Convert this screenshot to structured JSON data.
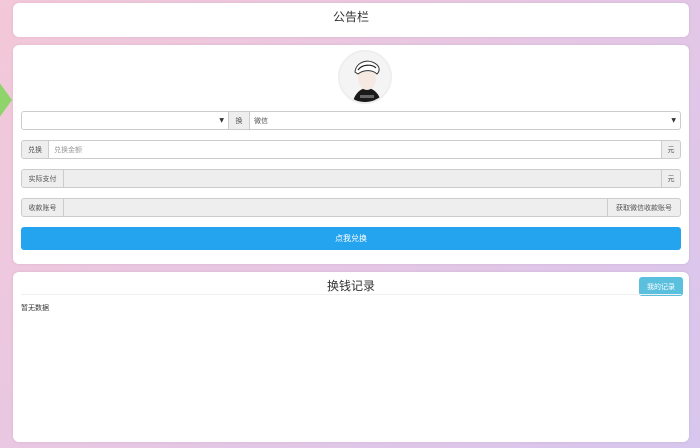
{
  "notice": {
    "title": "公告栏"
  },
  "form": {
    "from_select": {
      "value": ""
    },
    "swap_label": "换",
    "to_select": {
      "value": "微信"
    },
    "amount": {
      "label": "兑换",
      "placeholder": "兑换金额",
      "unit": "元"
    },
    "actual_pay": {
      "label": "实际支付",
      "value": "",
      "unit": "元"
    },
    "account": {
      "label": "收款账号",
      "value": "",
      "fetch_button": "获取微信收款账号"
    },
    "submit_label": "点我兑换"
  },
  "records": {
    "title": "换钱记录",
    "my_records_button": "我的记录",
    "empty_text": "暂无数据"
  }
}
